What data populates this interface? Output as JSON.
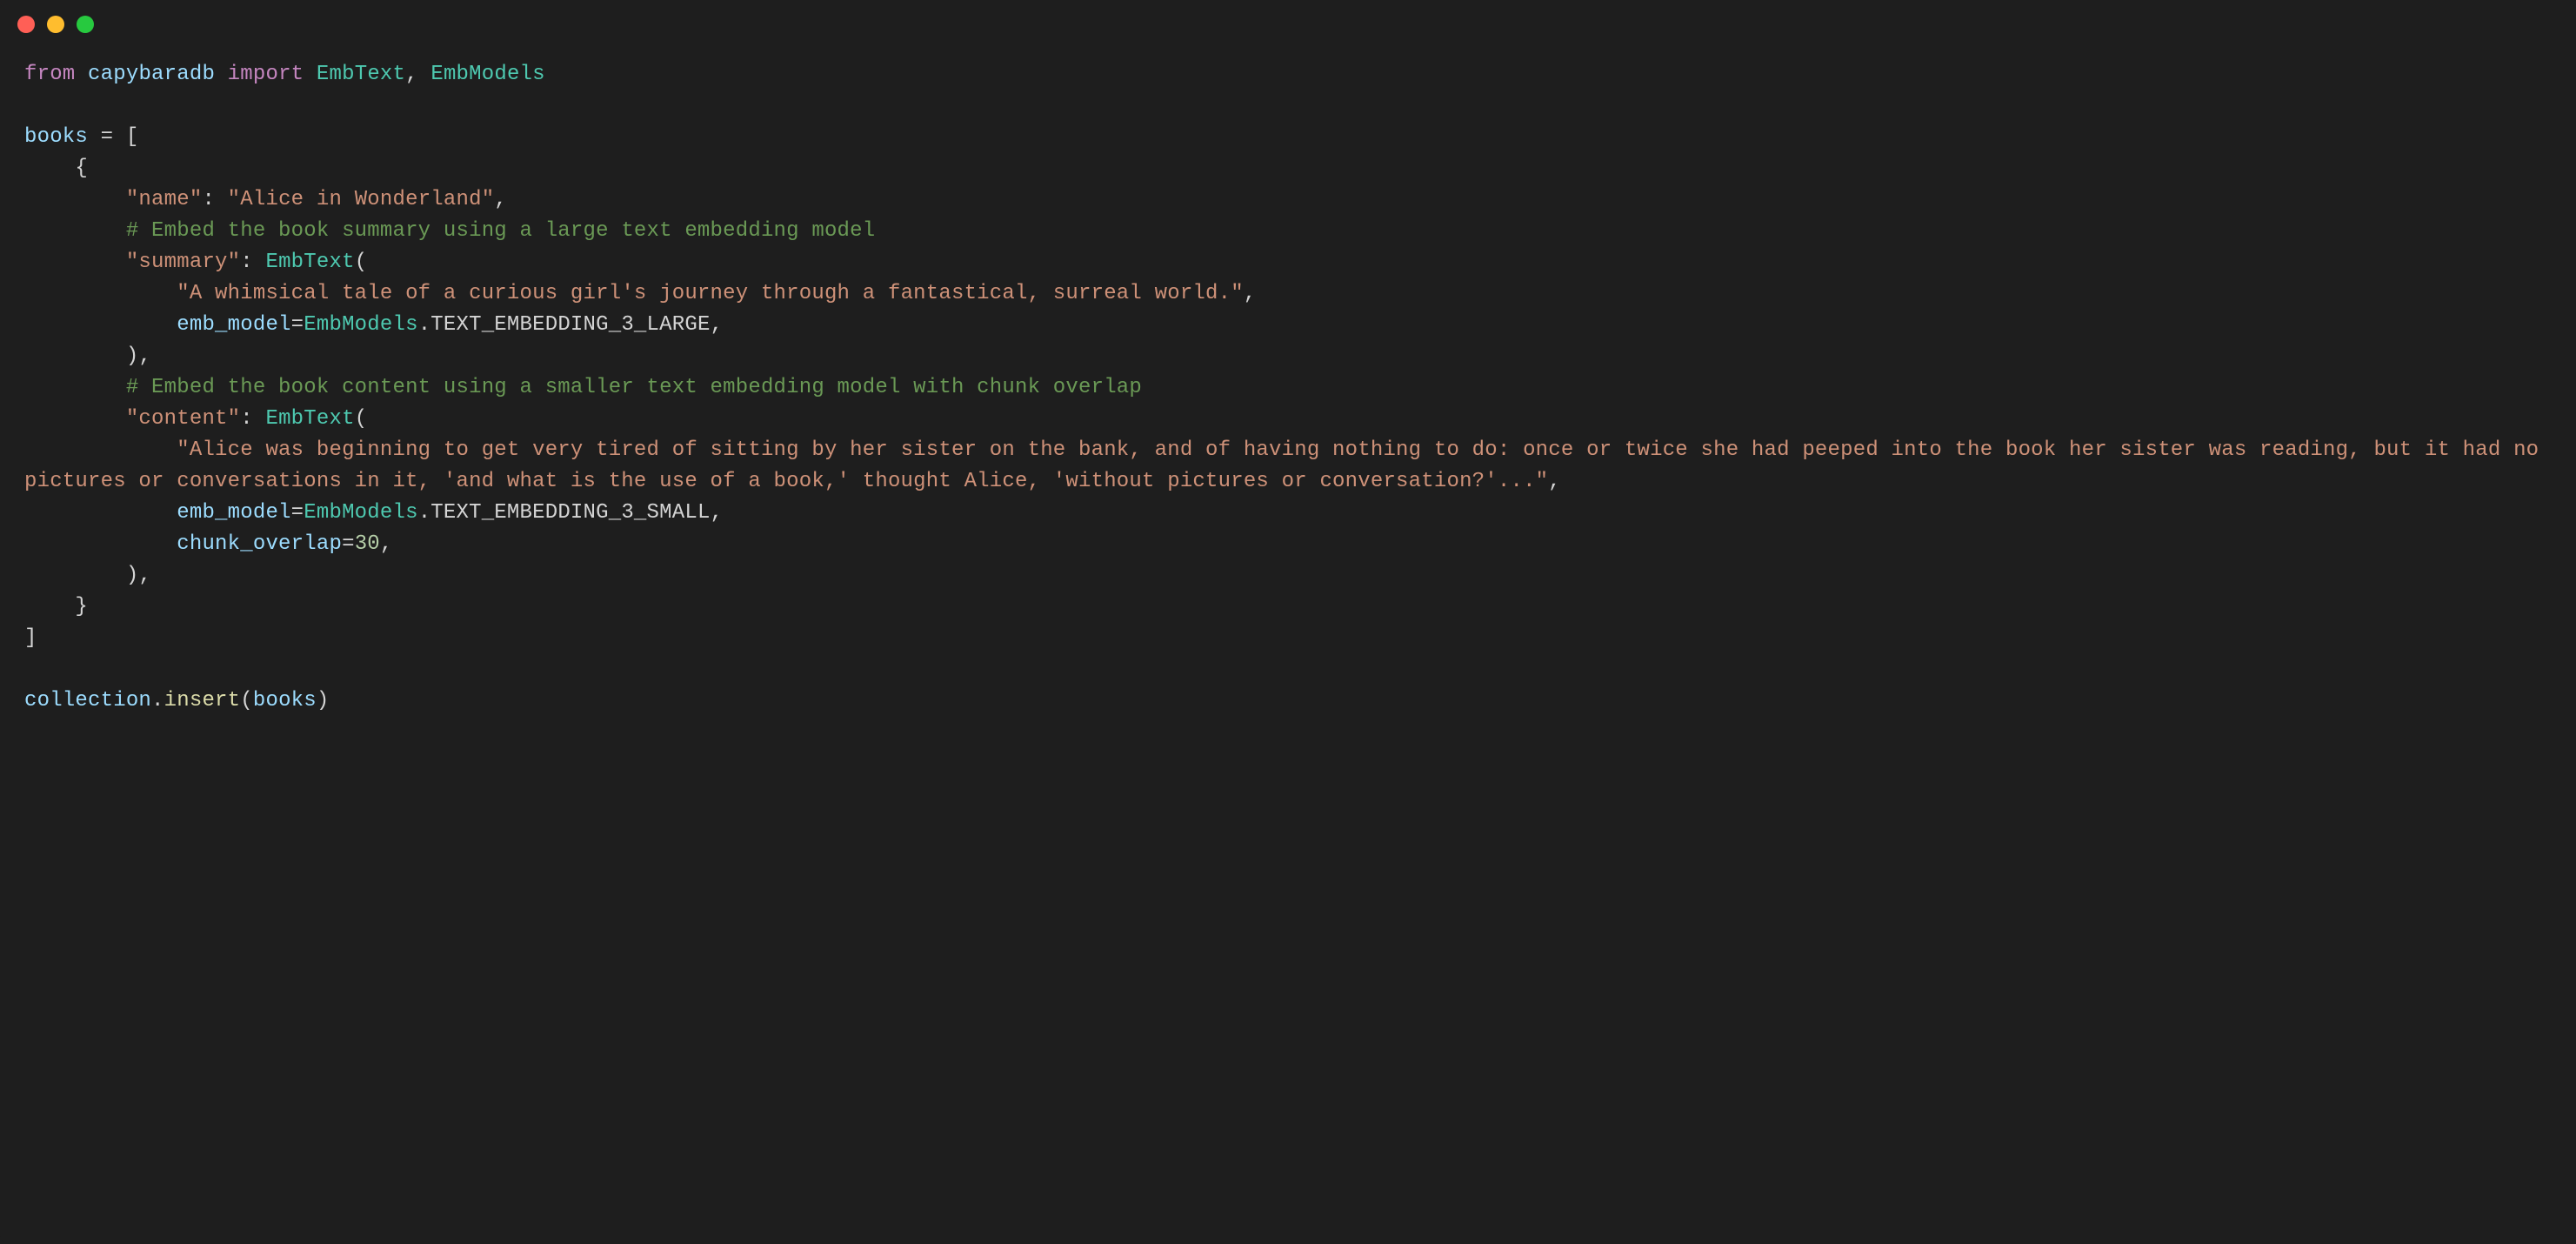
{
  "titlebar": {
    "close": "close",
    "minimize": "minimize",
    "maximize": "maximize"
  },
  "code": {
    "kw_from": "from",
    "mod_capybaradb": "capybaradb",
    "kw_import": "import",
    "cls_embtext": "EmbText",
    "comma_sp": ", ",
    "cls_embmodels": "EmbModels",
    "id_books": "books",
    "eq": " = ",
    "lbracket": "[",
    "lbrace": "{",
    "key_name": "\"name\"",
    "colon": ": ",
    "str_alice_title": "\"Alice in Wonderland\"",
    "comma": ",",
    "cmt_summary": "# Embed the book summary using a large text embedding model",
    "key_summary": "\"summary\"",
    "lparen": "(",
    "str_summary": "\"A whimsical tale of a curious girl's journey through a fantastical, surreal world.\"",
    "param_emb_model": "emb_model",
    "eq2": "=",
    "dot": ".",
    "const_large": "TEXT_EMBEDDING_3_LARGE",
    "rparen": ")",
    "cmt_content": "# Embed the book content using a smaller text embedding model with chunk overlap",
    "key_content": "\"content\"",
    "str_content": "\"Alice was beginning to get very tired of sitting by her sister on the bank, and of having nothing to do: once or twice she had peeped into the book her sister was reading, but it had no pictures or conversations in it, 'and what is the use of a book,' thought Alice, 'without pictures or conversation?'...\"",
    "const_small": "TEXT_EMBEDDING_3_SMALL",
    "param_chunk_overlap": "chunk_overlap",
    "num_30": "30",
    "rbrace": "}",
    "rbracket": "]",
    "id_collection": "collection",
    "fn_insert": "insert"
  }
}
